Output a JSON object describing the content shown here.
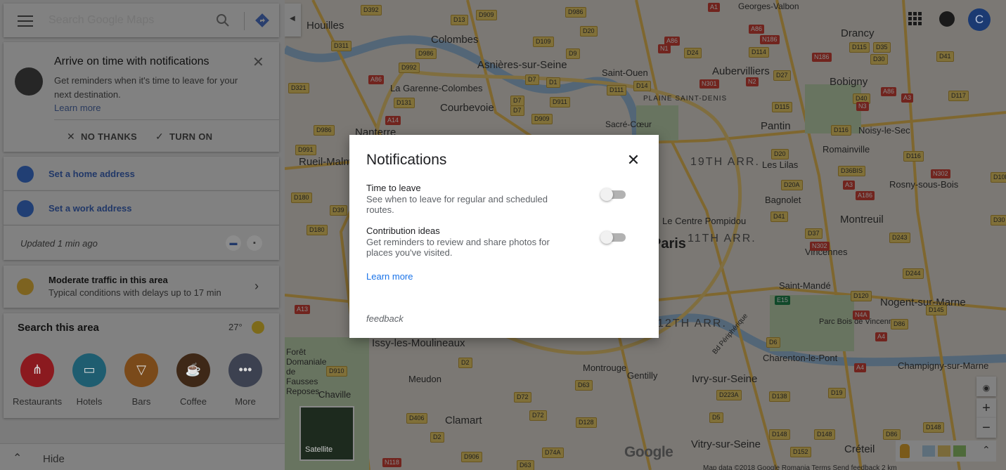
{
  "search": {
    "placeholder": "Search Google Maps"
  },
  "notification_card": {
    "title": "Arrive on time with notifications",
    "body": "Get reminders when it's time to leave for your next destination.",
    "learn_more": "Learn more",
    "no_thanks": "NO THANKS",
    "turn_on": "TURN ON"
  },
  "addresses": {
    "home": "Set a home address",
    "work": "Set a work address"
  },
  "updated": "Updated 1 min ago",
  "traffic": {
    "title": "Moderate traffic in this area",
    "subtitle": "Typical conditions with delays up to 17 min"
  },
  "area": {
    "title": "Search this area",
    "temperature": "27°",
    "categories": [
      {
        "label": "Restaurants",
        "icon": "fork-knife-icon",
        "color": "#8b1a1f"
      },
      {
        "label": "Hotels",
        "icon": "bed-icon",
        "color": "#1f5d70"
      },
      {
        "label": "Bars",
        "icon": "cocktail-icon",
        "color": "#7a4a1a"
      },
      {
        "label": "Coffee",
        "icon": "coffee-cup-icon",
        "color": "#3e2817"
      },
      {
        "label": "More",
        "icon": "more-dots-icon",
        "color": "#3c4150"
      }
    ]
  },
  "hide_label": "Hide",
  "account_initial": "C",
  "map": {
    "satellite_label": "Satellite",
    "logo": "Google",
    "footer": "Map data ©2018 Google   Romania   Terms   Send feedback   2 km",
    "places": [
      "Colombes",
      "Asnières-sur-Seine",
      "La Garenne-Colombes",
      "Courbevoie",
      "Nanterre",
      "Rueil-Malmaison",
      "Saint-Ouen",
      "Aubervilliers",
      "Drancy",
      "Bobigny",
      "Pantin",
      "Noisy-le-Sec",
      "Les Lilas",
      "Romainville",
      "Bagnolet",
      "Montreuil",
      "Rosny-sous-Bois",
      "Vincennes",
      "Saint-Mandé",
      "Nogent-sur-Marne",
      "Charenton-le-Pont",
      "Champigny-sur-Marne",
      "Ivry-sur-Seine",
      "Vitry-sur-Seine",
      "Créteil",
      "Issy-les-Moulineaux",
      "Montrouge",
      "Gentilly",
      "Clamart",
      "Meudon",
      "Chaville",
      "Forêt Domaniale de Fausses Reposes",
      "Sacré-Cœur",
      "Le Centre Pompidou",
      "Paris",
      "Houilles",
      "Parc Bois de Vincennes",
      "Bd Périphérique",
      "Georges-Valbon"
    ],
    "districts": [
      "19TH ARR.",
      "11TH ARR.",
      "12TH ARR.",
      "PLAINE SAINT-DENIS"
    ]
  },
  "dialog": {
    "title": "Notifications",
    "settings": [
      {
        "name": "Time to leave",
        "description": "See when to leave for regular and scheduled routes.",
        "enabled": false
      },
      {
        "name": "Contribution ideas",
        "description": "Get reminders to review and share photos for places you've visited.",
        "enabled": false
      }
    ],
    "learn_more": "Learn more",
    "feedback": "feedback"
  }
}
